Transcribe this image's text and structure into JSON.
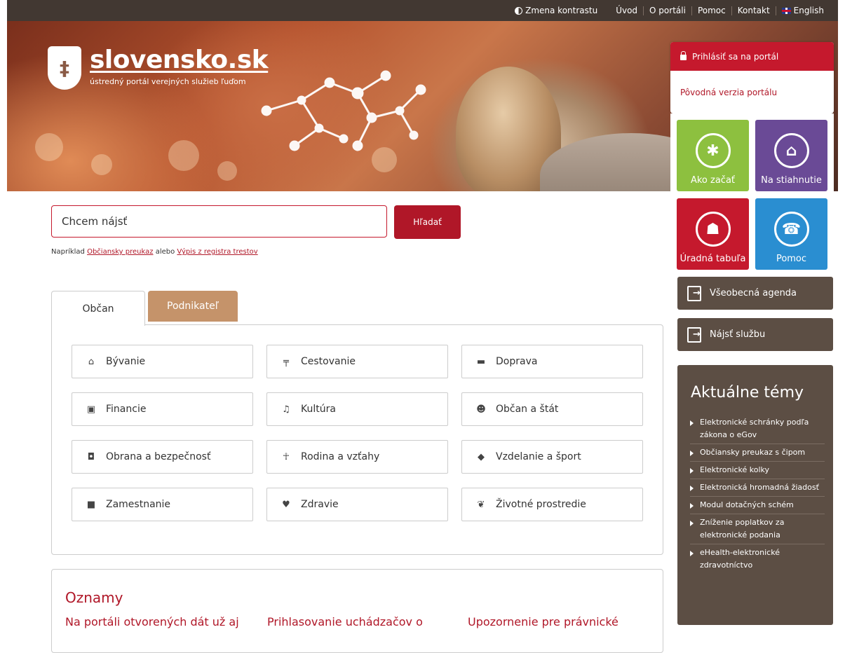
{
  "topbar": {
    "contrast": "Zmena kontrastu",
    "links": [
      "Úvod",
      "O portáli",
      "Pomoc",
      "Kontakt"
    ],
    "language": "English"
  },
  "logo": {
    "title": "slovensko.sk",
    "subtitle": "ústredný portál verejných služieb ľuďom"
  },
  "login": {
    "login_label": "Prihlásiť sa na portál",
    "original_version": "Pôvodná verzia portálu"
  },
  "tiles": [
    {
      "label": "Ako začať",
      "color": "#8dc03f",
      "icon": "lightbulb-icon"
    },
    {
      "label": "Na stiahnutie",
      "color": "#6a4a96",
      "icon": "download-person-icon"
    },
    {
      "label": "Úradná tabuľa",
      "color": "#c5192d",
      "icon": "board-person-icon"
    },
    {
      "label": "Pomoc",
      "color": "#2a8ed1",
      "icon": "phone-icon"
    }
  ],
  "search": {
    "placeholder": "Chcem nájsť",
    "button": "Hľadať",
    "example_prefix": "Napríklad ",
    "example_link1": "Občiansky preukaz",
    "example_mid": " alebo ",
    "example_link2": "Výpis z registra trestov"
  },
  "tabs": {
    "citizen": "Občan",
    "business": "Podnikateľ"
  },
  "categories": [
    {
      "label": "Bývanie",
      "icon": "home-icon"
    },
    {
      "label": "Cestovanie",
      "icon": "signpost-icon"
    },
    {
      "label": "Doprava",
      "icon": "car-icon"
    },
    {
      "label": "Financie",
      "icon": "money-icon"
    },
    {
      "label": "Kultúra",
      "icon": "music-icon"
    },
    {
      "label": "Občan a štát",
      "icon": "users-icon"
    },
    {
      "label": "Obrana a bezpečnosť",
      "icon": "shield-icon"
    },
    {
      "label": "Rodina a vzťahy",
      "icon": "child-icon"
    },
    {
      "label": "Vzdelanie a šport",
      "icon": "graduation-cap-icon"
    },
    {
      "label": "Zamestnanie",
      "icon": "briefcase-icon"
    },
    {
      "label": "Zdravie",
      "icon": "heartbeat-icon"
    },
    {
      "label": "Životné prostredie",
      "icon": "leaf-icon"
    }
  ],
  "side": {
    "agenda": "Všeobecná agenda",
    "find_service": "Nájsť službu"
  },
  "topics": {
    "title": "Aktuálne témy",
    "items": [
      "Elektronické schránky podľa zákona o eGov",
      "Občiansky preukaz s čipom",
      "Elektronické kolky",
      "Elektronická hromadná žiadosť",
      "Modul dotačných schém",
      "Zníženie poplatkov za elektronické podania",
      "eHealth-elektronické zdravotníctvo"
    ]
  },
  "notices": {
    "title": "Oznamy",
    "items": [
      "Na portáli otvorených dát už aj",
      "Prihlasovanie uchádzačov o",
      "Upozornenie pre právnické"
    ]
  }
}
